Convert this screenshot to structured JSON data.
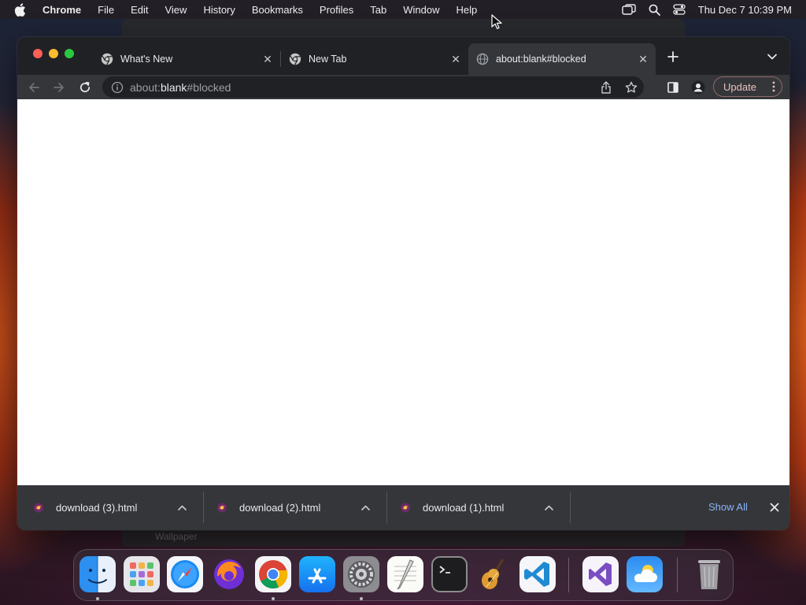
{
  "menubar": {
    "app_name": "Chrome",
    "items": [
      "File",
      "Edit",
      "View",
      "History",
      "Bookmarks",
      "Profiles",
      "Tab",
      "Window",
      "Help"
    ],
    "clock": "Thu Dec 7  10:39 PM"
  },
  "background_window": {
    "label": "Wallpaper"
  },
  "tabs": [
    {
      "title": "What's New",
      "icon": "chrome-icon",
      "active": false
    },
    {
      "title": "New Tab",
      "icon": "chrome-icon",
      "active": false
    },
    {
      "title": "about:blank#blocked",
      "icon": "globe-icon",
      "active": true
    }
  ],
  "omnibox": {
    "scheme": "about:",
    "host": "blank",
    "fragment": "#blocked"
  },
  "toolbar": {
    "update_label": "Update"
  },
  "downloads": {
    "items": [
      {
        "filename": "download (3).html"
      },
      {
        "filename": "download (2).html"
      },
      {
        "filename": "download (1).html"
      }
    ],
    "show_all_label": "Show All"
  },
  "dock": {
    "apps": [
      "Finder",
      "Launchpad",
      "Safari",
      "Firefox",
      "Google Chrome",
      "App Store",
      "System Settings",
      "TextEdit",
      "Terminal",
      "GarageBand",
      "Visual Studio Code",
      "Visual Studio",
      "Weather",
      "Trash"
    ]
  },
  "colors": {
    "accent_link": "#8ab4f8",
    "window_bg": "#202124",
    "toolbar_bg": "#35363a"
  }
}
